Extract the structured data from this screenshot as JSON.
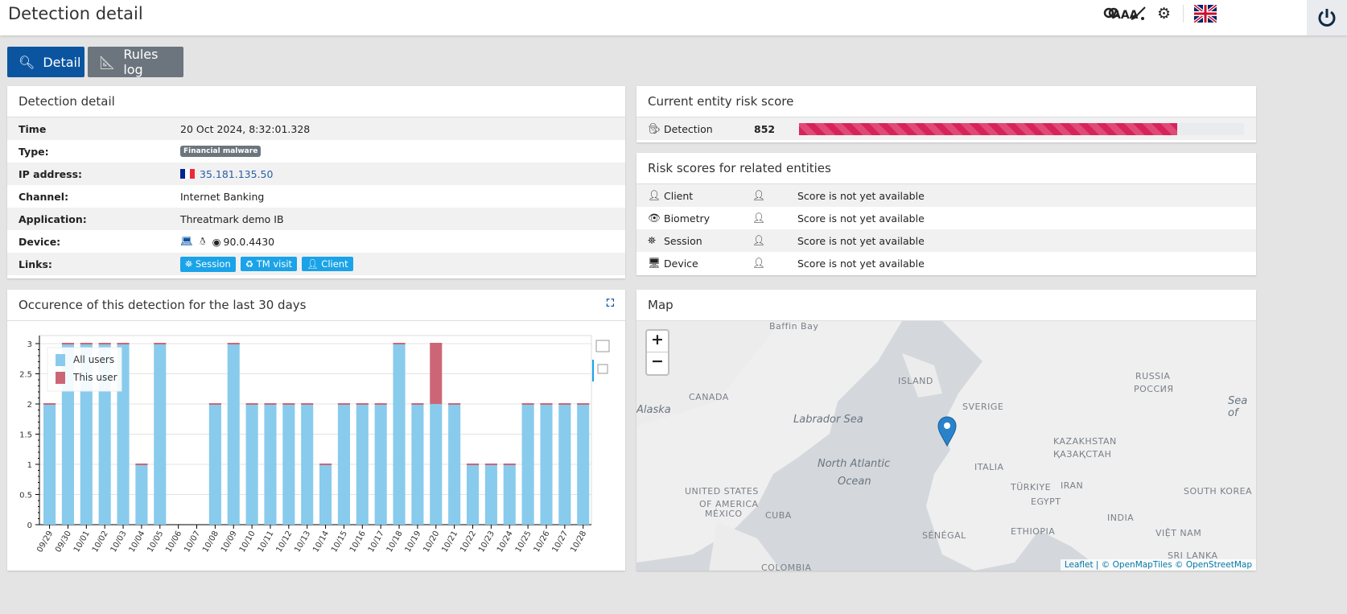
{
  "header": {
    "title": "Detection detail",
    "icons": [
      "text-size-icon",
      "contrast-toggle-icon",
      "broom-icon",
      "gear-icon",
      "uk-flag-icon",
      "power-icon"
    ],
    "text_size_glyph": "AAA"
  },
  "tabs": [
    {
      "label": "Detail",
      "icon": "search-icon",
      "active": true
    },
    {
      "label": "Rules log",
      "icon": "ruler-icon",
      "active": false
    }
  ],
  "detection": {
    "title": "Detection detail",
    "rows": [
      {
        "label": "Time",
        "value": "20 Oct 2024, 8:32:01.328"
      },
      {
        "label": "Type:",
        "value": "Financial malware"
      },
      {
        "label": "IP address:",
        "value": "35.181.135.50",
        "flag": "FR"
      },
      {
        "label": "Channel:",
        "value": "Internet Banking"
      },
      {
        "label": "Application:",
        "value": "Threatmark demo IB"
      },
      {
        "label": "Device:",
        "value": "90.0.4430",
        "icons": [
          "laptop-icon",
          "linux-icon",
          "chrome-icon"
        ]
      },
      {
        "label": "Links:",
        "links": [
          "Session",
          "TM visit",
          "Client"
        ]
      }
    ]
  },
  "risk": {
    "title": "Current entity risk score",
    "label": "Detection",
    "score": "852",
    "fill_percent": 85,
    "color": "#d6245a"
  },
  "related": {
    "title": "Risk scores for related entities",
    "rows": [
      {
        "label": "Client",
        "icon": "user-icon",
        "status": "Score is not yet available"
      },
      {
        "label": "Biometry",
        "icon": "eye-icon",
        "status": "Score is not yet available"
      },
      {
        "label": "Session",
        "icon": "binoculars-icon",
        "status": "Score is not yet available"
      },
      {
        "label": "Device",
        "icon": "monitor-icon",
        "status": "Score is not yet available"
      }
    ]
  },
  "occurrence": {
    "title": "Occurence of this detection for the last 30 days"
  },
  "chart_data": {
    "type": "bar",
    "stacked": true,
    "categories": [
      "09/29",
      "09/30",
      "10/01",
      "10/02",
      "10/03",
      "10/04",
      "10/05",
      "10/06",
      "10/07",
      "10/08",
      "10/09",
      "10/10",
      "10/11",
      "10/12",
      "10/13",
      "10/14",
      "10/15",
      "10/16",
      "10/17",
      "10/18",
      "10/19",
      "10/20",
      "10/21",
      "10/22",
      "10/23",
      "10/24",
      "10/25",
      "10/26",
      "10/27",
      "10/28"
    ],
    "series": [
      {
        "name": "All users",
        "color": "#88cbec",
        "values": [
          2,
          3,
          3,
          3,
          3,
          1,
          3,
          0,
          0,
          2,
          3,
          2,
          2,
          2,
          2,
          1,
          2,
          2,
          2,
          3,
          2,
          2,
          2,
          1,
          1,
          1,
          2,
          2,
          2,
          2
        ]
      },
      {
        "name": "This user",
        "color": "#cc6677",
        "values": [
          0,
          0,
          0,
          0,
          0,
          0,
          0,
          0,
          0,
          0,
          0,
          0,
          0,
          0,
          0,
          0,
          0,
          0,
          0,
          0,
          0,
          1,
          0,
          0,
          0,
          0,
          0,
          0,
          0,
          0
        ]
      }
    ],
    "ylim": [
      0,
      3
    ],
    "yticks": [
      "0",
      "0.5",
      "1",
      "1.5",
      "2",
      "2.5",
      "3"
    ],
    "grid": true,
    "legend": "top-left"
  },
  "map": {
    "title": "Map",
    "zoom_in": "+",
    "zoom_out": "−",
    "attribution": "Leaflet | © OpenMapTiles © OpenStreetMap",
    "labels": [
      "Baffin Bay",
      "CANADA",
      "Alaska",
      "ISLAND",
      "Labrador Sea",
      "SVERIGE",
      "RUSSIA",
      "РОССИЯ",
      "UNITED STATES",
      "OF AMERICA",
      "North Atlantic",
      "Ocean",
      "KAZAKHSTAN",
      "ҚАЗАҚСТАН",
      "ITALIA",
      "TÜRKIYE",
      "IRAN",
      "EGYPT",
      "MÉXICO",
      "CUBA",
      "SÉNÉGAL",
      "ETHIOPIA",
      "INDIA",
      "SOUTH KOREA",
      "VIỆT NAM",
      "SRI LANKA",
      "COLOMBIA",
      "Sea of"
    ]
  }
}
